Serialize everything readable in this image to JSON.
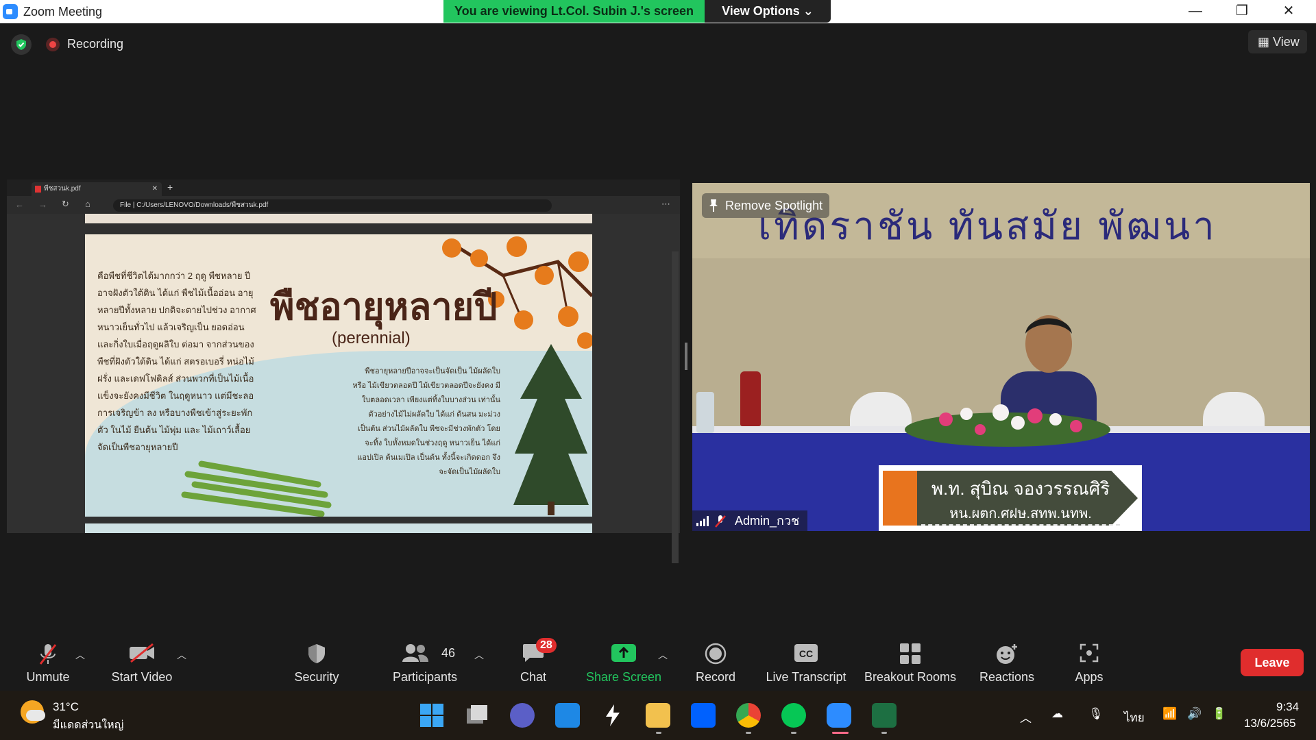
{
  "window": {
    "title": "Zoom Meeting",
    "viewing_banner": "You are viewing Lt.Col. Subin J.'s screen",
    "view_options": "View Options",
    "minimize": "—",
    "restore": "❐",
    "close": "✕"
  },
  "topbar": {
    "recording_label": "Recording",
    "view_label": "View"
  },
  "shared_screen": {
    "tab_title": "พืชสวนk.pdf",
    "url_prefix": "File",
    "url": "C:/Users/LENOVO/Downloads/พืชสวนk.pdf",
    "slide": {
      "title": "พืชอายุหลายปี",
      "subtitle": "(perennial)",
      "left_text": "คือพืชที่ชีวิตได้มากกว่า 2 ฤดู พืชหลาย ปีอาจฝังตัวใต้ดิน ได้แก่ พืชไม้เนื้ออ่อน อายุหลายปีทั้งหลาย ปกติจะตายไปช่วง อากาศหนาวเย็นทั่วไป แล้วเจริญเป็น ยอดอ่อน และกิ่งใบเมื่อฤดูผลิใบ ต่อมา จากส่วนของพืชที่ฝังตัวใต้ดิน ได้แก่ สตรอเบอรี่ หน่อไม้ฝรั่ง และเดฟโฟดิลส์ ส่วนพวกที่เป็นไม้เนื้อแข็งจะยังคงมีชีวิต ในฤดูหนาว แต่มีชะลอการเจริญข้า ลง หรือบางพืชเข้าสู่ระยะพักตัว ในไม้ ยืนต้น ไม้พุ่ม และ ไม้เถาว์เลื้อย จัดเป็นพืชอายุหลายปี",
      "right_text": "พืชอายุหลายปีอาจจะเป็นจัดเป็น ไม้ผลัดใบ หรือ ไม้เขียวตลอดปี ไม้เขียวตลอดปีจะยังคง มีใบตลอดเวลา เพียงแต่ทิ้งใบบางส่วน เท่านั้น ตัวอย่างไม้ไม่ผลัดใบ ได้แก่ ต้นสน มะม่วง เป็นต้น ส่วนไม้ผลัดใบ พืชจะมีช่วงพักตัว โดยจะทิ้ง ใบทั้งหมดในช่วงฤดู หนาวเย็น ได้แก่ แอปเปิล ต้นเมเปิล เป็นต้น ทั้งนี้จะเกิดดอก จึงจะจัดเป็นไม้ผลัดใบ"
    }
  },
  "video": {
    "banner_text": "เทิดราชัน     ทันสมัย     พัฒนา",
    "remove_spotlight": "Remove Spotlight",
    "participant_name": "Admin_กวช",
    "nameplate_line1": "พ.ท. สุบิณ  จองวรรณศิริ",
    "nameplate_line2": "หน.ผตก.ศฝษ.สทพ.นทพ."
  },
  "toolbar": {
    "unmute": "Unmute",
    "start_video": "Start Video",
    "security": "Security",
    "participants": "Participants",
    "participants_count": "46",
    "chat": "Chat",
    "chat_badge": "28",
    "share_screen": "Share Screen",
    "record": "Record",
    "live_transcript": "Live Transcript",
    "breakout_rooms": "Breakout Rooms",
    "reactions": "Reactions",
    "apps": "Apps",
    "leave": "Leave"
  },
  "taskbar": {
    "temperature": "31°C",
    "weather": "มีแดดส่วนใหญ่",
    "language": "ไทย",
    "time": "9:34",
    "date": "13/6/2565"
  },
  "colors": {
    "green_banner": "#22c55e",
    "leave_red": "#e02d2d",
    "share_green": "#22c55e"
  }
}
